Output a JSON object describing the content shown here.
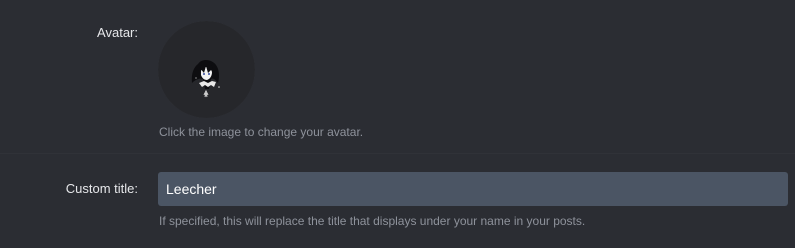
{
  "avatar": {
    "label": "Avatar:",
    "hint": "Click the image to change your avatar."
  },
  "custom_title": {
    "label": "Custom title:",
    "value": "Leecher",
    "hint": "If specified, this will replace the title that displays under your name in your posts."
  },
  "colors": {
    "background": "#2b2d33",
    "input_background": "#4b5564",
    "label_text": "#e6e7ea",
    "hint_text": "#8e929b"
  }
}
